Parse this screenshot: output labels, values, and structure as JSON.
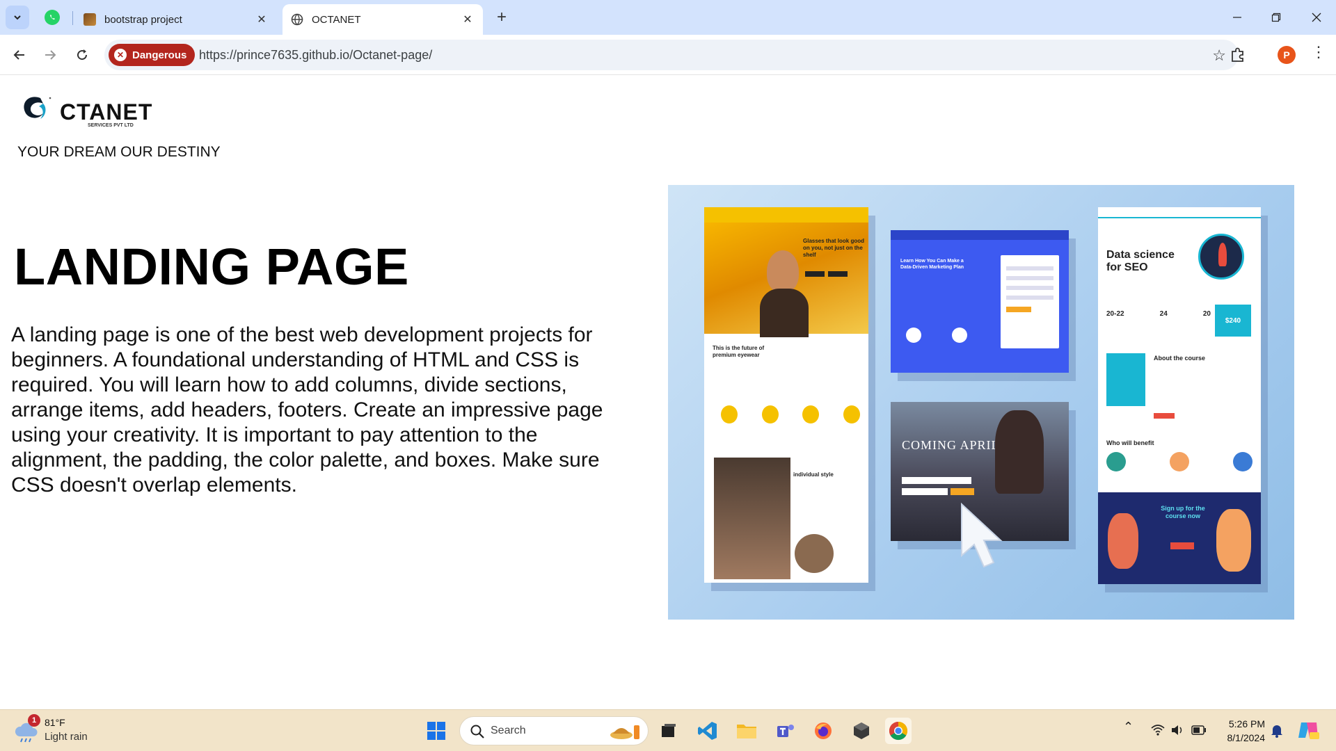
{
  "browser": {
    "tabs": [
      {
        "title": "bootstrap project",
        "active": false
      },
      {
        "title": "OCTANET",
        "active": true
      }
    ],
    "security_chip": "Dangerous",
    "url": "https://prince7635.github.io/Octanet-page/",
    "profile_initial": "P"
  },
  "page": {
    "logo": {
      "text": "CTANET",
      "subtext": "SERVICES PVT LTD"
    },
    "tagline": "YOUR DREAM OUR DESTINY",
    "headline": "LANDING PAGE",
    "description": "A landing page is one of the best web development projects for beginners. A foundational understanding of HTML and CSS is required. You will learn how to add columns, divide sections, arrange items, add headers, footers. Create an impressive page using your creativity. It is important to pay attention to the alignment, the padding, the color palette, and boxes. Make sure CSS doesn't overlap elements.",
    "hero_image": {
      "mock1_heading": "Glasses that look good on you, not just on the shelf",
      "mock1_sub": "This is the future of premium eyewear",
      "mock1_style": "individual style",
      "mock2_heading": "Learn How You Can Make a Data-Driven Marketing Plan",
      "mock3_heading": "COMING APRIL 2023",
      "mock4_heading": "Data science for SEO",
      "mock4_stats": [
        "20-22",
        "24",
        "20",
        "$240"
      ],
      "mock4_about": "About the course",
      "mock4_benefit": "Who will benefit",
      "mock4_signup": "Sign up for the course now"
    }
  },
  "taskbar": {
    "weather_badge": "1",
    "temperature": "81°F",
    "condition": "Light rain",
    "search_label": "Search",
    "time": "5:26 PM",
    "date": "8/1/2024"
  },
  "colors": {
    "tabbar": "#d3e3fd",
    "danger": "#b3261e",
    "taskbar": "#f2e4c9",
    "accent_blue": "#3d5af1",
    "accent_yellow": "#f5c100",
    "accent_cyan": "#19b6d2"
  }
}
